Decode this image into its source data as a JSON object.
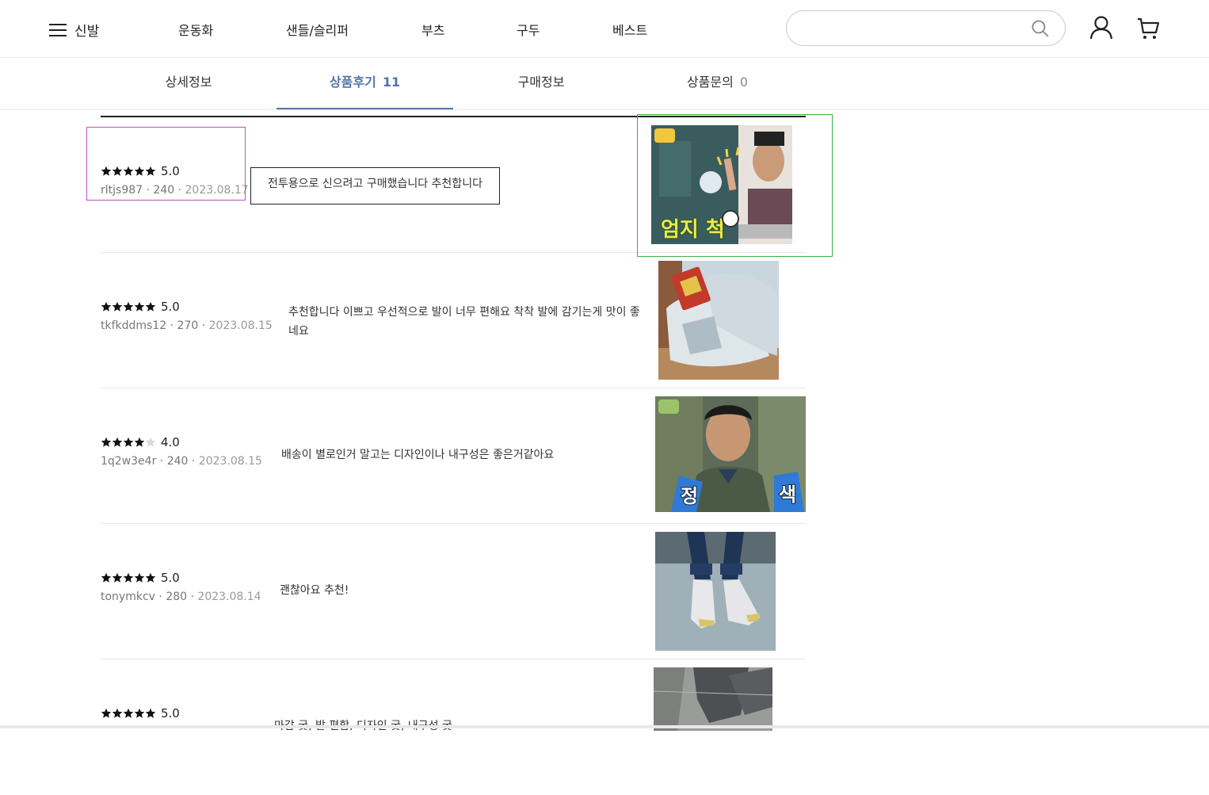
{
  "header": {
    "menu_label": "신발",
    "categories": [
      "운동화",
      "샌들/슬리퍼",
      "부츠",
      "구두",
      "베스트"
    ],
    "search_placeholder": ""
  },
  "tabs": [
    {
      "label": "상세정보",
      "count": ""
    },
    {
      "label": "상품후기",
      "count": "11"
    },
    {
      "label": "구매정보",
      "count": ""
    },
    {
      "label": "상품문의",
      "count": "0"
    }
  ],
  "reviews": [
    {
      "stars": 5,
      "rating": "5.0",
      "user": "rltjs987",
      "size": "240",
      "date": "2023.08.17",
      "text": "전투용으로 신으려고 구매했습니다 추천합니다",
      "image": "man-thumbs-up-caption-엄지 척",
      "image_caption": "엄지 척"
    },
    {
      "stars": 5,
      "rating": "5.0",
      "user": "tkfkddms12",
      "size": "270",
      "date": "2023.08.15",
      "text": "추천합니다 이쁘고 우선적으로 발이 너무 편해요 착착 발에 감기는게 맛이 좋네요",
      "image": "grey-sneakers-in-box"
    },
    {
      "stars": 4,
      "rating": "4.0",
      "user": "1q2w3e4r",
      "size": "240",
      "date": "2023.08.15",
      "text": "배송이 별로인거 말고는 디자인이나 내구성은 좋은거같아요",
      "image": "man-green-vest-caption-정색",
      "image_caption_left": "정",
      "image_caption_right": "색"
    },
    {
      "stars": 5,
      "rating": "5.0",
      "user": "tonymkcv",
      "size": "280",
      "date": "2023.08.14",
      "text": "괜찮아요 추천!",
      "image": "sneakers-worn-with-jeans"
    },
    {
      "stars": 5,
      "rating": "5.0",
      "user": "",
      "size": "",
      "date": "",
      "text": "마감 굿, 발 편함, 디자인 굿, 내구성 굿",
      "image": "grey-pants-on-pavement"
    }
  ],
  "colors": {
    "accent": "#5474a8",
    "star": "#111111",
    "star_empty": "#d9d9d9"
  }
}
